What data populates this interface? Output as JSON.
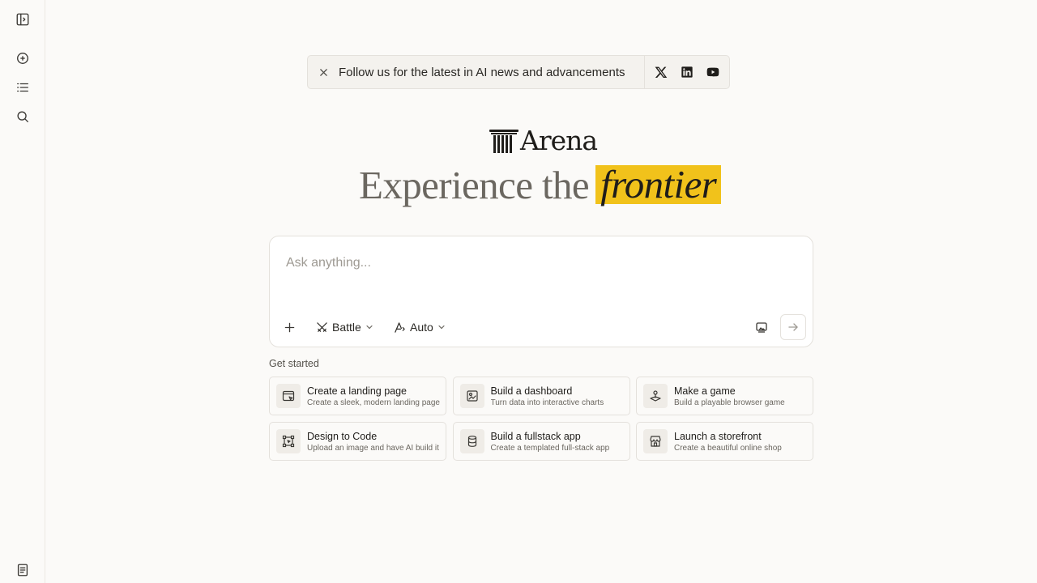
{
  "banner": {
    "text": "Follow us for the latest in AI news and advancements",
    "social": [
      "x-icon",
      "linkedin-icon",
      "youtube-icon"
    ]
  },
  "logo": {
    "text": "Arena"
  },
  "headline": {
    "prefix": "Experience the",
    "highlight": "frontier",
    "highlight_color": "#f1c21b"
  },
  "composer": {
    "placeholder": "Ask anything...",
    "mode": "Battle",
    "model": "Auto"
  },
  "get_started": {
    "label": "Get started",
    "cards": [
      {
        "title": "Create a landing page",
        "subtitle": "Create a sleek, modern landing page",
        "icon": "browser-icon"
      },
      {
        "title": "Build a dashboard",
        "subtitle": "Turn data into interactive charts",
        "icon": "chart-icon"
      },
      {
        "title": "Make a game",
        "subtitle": "Build a playable browser game",
        "icon": "joystick-icon"
      },
      {
        "title": "Design to Code",
        "subtitle": "Upload an image and have AI build it",
        "icon": "frame-icon"
      },
      {
        "title": "Build a fullstack app",
        "subtitle": "Create a templated full-stack app",
        "icon": "database-icon"
      },
      {
        "title": "Launch a storefront",
        "subtitle": "Create a beautiful online shop",
        "icon": "store-icon"
      }
    ]
  },
  "colors": {
    "background": "#fbfaf8",
    "accent": "#f1c21b",
    "border": "#e4e1dc"
  }
}
